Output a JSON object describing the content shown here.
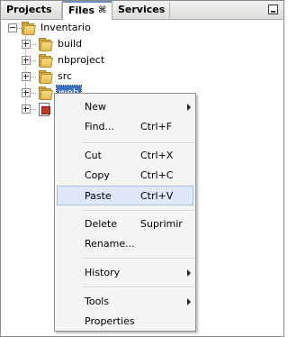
{
  "tabs": [
    {
      "label": "Projects"
    },
    {
      "label": "Files",
      "close": "⌘"
    },
    {
      "label": "Services"
    }
  ],
  "tree": {
    "root": {
      "label": "Inventario",
      "icon": "folder-icon"
    },
    "children": [
      {
        "label": "build",
        "icon": "folder-icon"
      },
      {
        "label": "nbproject",
        "icon": "folder-icon"
      },
      {
        "label": "src",
        "icon": "folder-icon"
      },
      {
        "label": "web",
        "icon": "folder-icon",
        "selected": true
      },
      {
        "label": "",
        "icon": "build-file-icon"
      }
    ]
  },
  "menu": {
    "items": [
      {
        "label": "New",
        "submenu": true
      },
      {
        "label": "Find...",
        "shortcut": "Ctrl+F"
      },
      {
        "label": "Cut",
        "shortcut": "Ctrl+X"
      },
      {
        "label": "Copy",
        "shortcut": "Ctrl+C"
      },
      {
        "label": "Paste",
        "shortcut": "Ctrl+V",
        "highlighted": true
      },
      {
        "label": "Delete",
        "shortcut": "Suprimir"
      },
      {
        "label": "Rename..."
      },
      {
        "label": "History",
        "submenu": true
      },
      {
        "label": "Tools",
        "submenu": true
      },
      {
        "label": "Properties"
      }
    ]
  },
  "colors": {
    "selection": "#3e6fc3",
    "menu_highlight": "#dfe8f6",
    "active_tab_accent": "#6d8fc6"
  }
}
